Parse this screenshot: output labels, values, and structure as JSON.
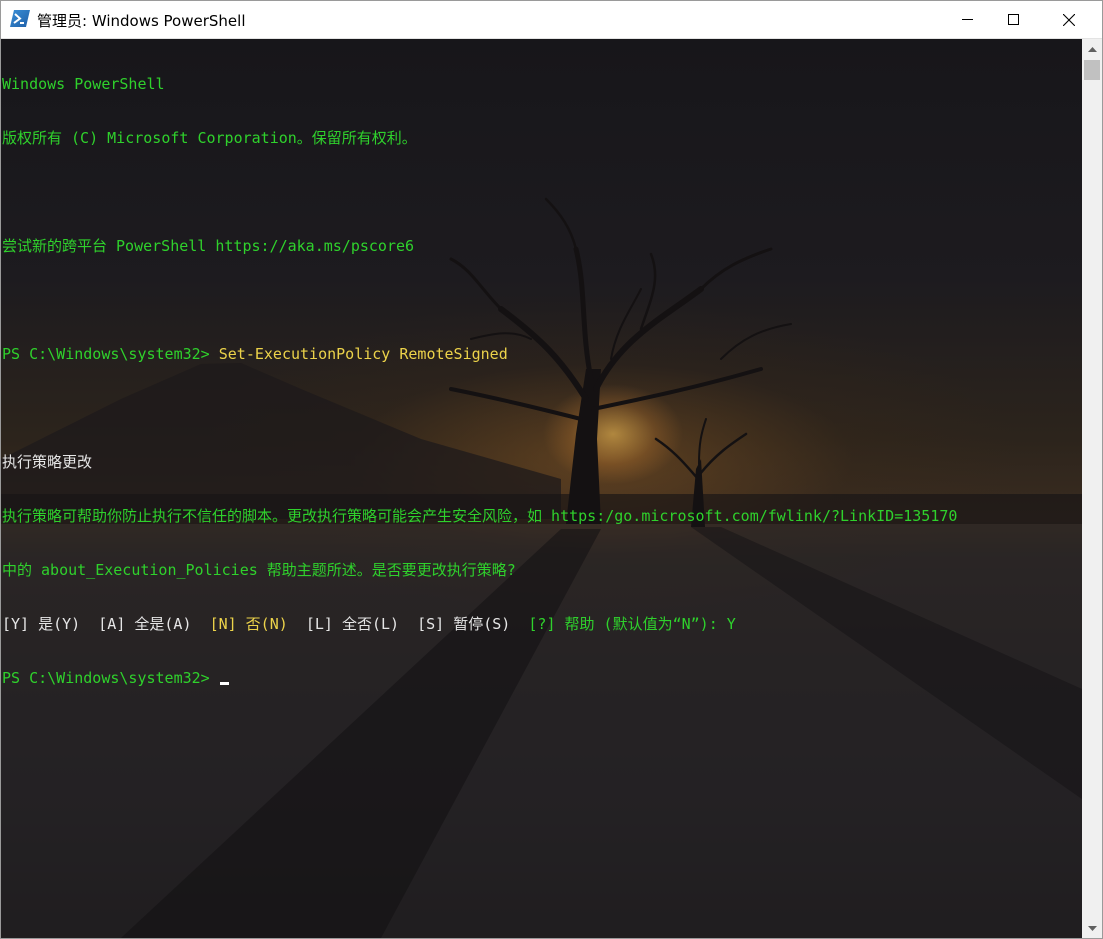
{
  "window": {
    "title": "管理员: Windows PowerShell",
    "icon": "powershell-icon",
    "controls": [
      "minimize-icon",
      "maximize-icon",
      "close-icon"
    ]
  },
  "colors": {
    "prompt_text": "#2fd12c",
    "plain_text": "#e6e6e6",
    "default_choice": "#ecd34a",
    "titlebar": "#ffffff"
  },
  "console": {
    "header": {
      "line1": "Windows PowerShell",
      "line2": "版权所有 (C) Microsoft Corporation。保留所有权利。",
      "line3": "尝试新的跨平台 PowerShell https://aka.ms/pscore6"
    },
    "command": {
      "prompt": "PS C:\\Windows\\system32> ",
      "text": "Set-ExecutionPolicy RemoteSigned"
    },
    "policy": {
      "heading": "执行策略更改",
      "message1": "执行策略可帮助你防止执行不信任的脚本。更改执行策略可能会产生安全风险，如 https:/go.microsoft.com/fwlink/?LinkID=135170",
      "message2": "中的 about_Execution_Policies 帮助主题所述。是否要更改执行策略?"
    },
    "choices": {
      "yes": "[Y] 是(Y)  ",
      "all": "[A] 全是(A)  ",
      "no": "[N] 否(N)  ",
      "no_all": "[L] 全否(L)  ",
      "suspend": "[S] 暂停(S)  ",
      "help": "[?] 帮助 (默认值为“N”): Y"
    },
    "final_prompt": "PS C:\\Windows\\system32> "
  }
}
